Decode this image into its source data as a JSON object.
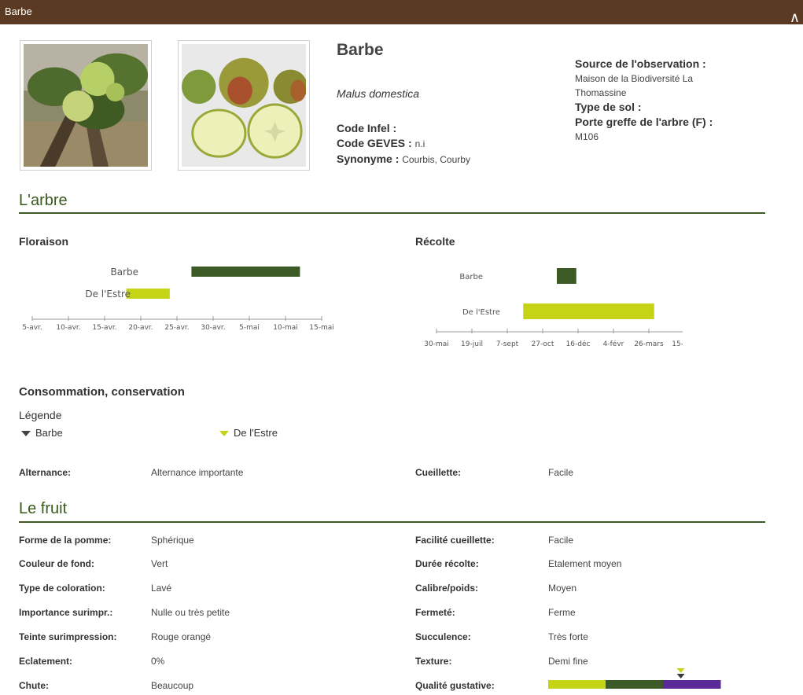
{
  "header": {
    "title": "Barbe",
    "collapse_icon": "chevron-up-icon"
  },
  "identity": {
    "name": "Barbe",
    "latin": "Malus domestica",
    "code_infel_label": "Code Infel :",
    "code_geves_label": "Code GEVES :",
    "code_geves_value": "n.i",
    "synonyme_label": "Synonyme :",
    "synonyme_value": "Courbis, Courby"
  },
  "source": {
    "source_label": "Source de l'observation :",
    "source_value_line1": "Maison de la Biodiversité La",
    "source_value_line2": "Thomassine",
    "sol_label": "Type de sol :",
    "porte_label": "Porte greffe de l'arbre (F) :",
    "porte_value": "M106"
  },
  "sections": {
    "arbre": "L'arbre",
    "floraison": "Floraison",
    "recolte": "Récolte",
    "consommation": "Consommation, conservation",
    "legende": "Légende",
    "fruit": "Le fruit"
  },
  "legend": {
    "item1": "Barbe",
    "item2": "De l'Estre"
  },
  "colors": {
    "dark_green": "#3b5a26",
    "lime": "#c5d416",
    "purple": "#5a2a96",
    "brown": "#5a3a22"
  },
  "chart_data": [
    {
      "type": "bar",
      "title": "Floraison",
      "categories": [
        "Barbe",
        "De l'Estre"
      ],
      "ticks": [
        "5-avr.",
        "10-avr.",
        "15-avr.",
        "20-avr.",
        "25-avr.",
        "30-avr.",
        "5-mai",
        "10-mai",
        "15-mai"
      ],
      "series": [
        {
          "name": "Barbe",
          "start": "27-avr.",
          "end": "12-mai"
        },
        {
          "name": "De l'Estre",
          "start": "18-avr.",
          "end": "24-avr."
        }
      ]
    },
    {
      "type": "bar",
      "title": "Récolte",
      "categories": [
        "Barbe",
        "De l'Estre"
      ],
      "ticks": [
        "30-mai",
        "19-juil",
        "7-sept",
        "27-oct",
        "16-déc",
        "4-févr",
        "26-mars",
        "15-mai"
      ],
      "series": [
        {
          "name": "Barbe",
          "start": "14-nov",
          "end": "2-déc"
        },
        {
          "name": "De l'Estre",
          "start": "9-oct",
          "end": "18-mars"
        }
      ]
    }
  ],
  "alternance": {
    "label": "Alternance:",
    "value": "Alternance importante",
    "cueillette_label": "Cueillette:",
    "cueillette_value": "Facile"
  },
  "fruit_left": [
    {
      "label": "Forme de la pomme:",
      "value": "Sphérique"
    },
    {
      "label": "Couleur de fond:",
      "value": "Vert"
    },
    {
      "label": "Type de coloration:",
      "value": "Lavé"
    },
    {
      "label": "Importance surimpr.:",
      "value": "Nulle ou très petite"
    },
    {
      "label": "Teinte surimpression:",
      "value": "Rouge orangé"
    },
    {
      "label": "Eclatement:",
      "value": "0%"
    },
    {
      "label": "Chute:",
      "value": "Beaucoup"
    }
  ],
  "fruit_right": [
    {
      "label": "Facilité cueillette:",
      "value": "Facile"
    },
    {
      "label": "Durée récolte:",
      "value": "Etalement moyen"
    },
    {
      "label": "Calibre/poids:",
      "value": "Moyen"
    },
    {
      "label": "Fermeté:",
      "value": "Ferme"
    },
    {
      "label": "Succulence:",
      "value": "Très forte"
    },
    {
      "label": "Texture:",
      "value": "Demi fine"
    },
    {
      "label": "Qualité gustative:",
      "value": ""
    }
  ],
  "qualite_gustative": {
    "segments": 3,
    "marker_position": 0.77
  }
}
